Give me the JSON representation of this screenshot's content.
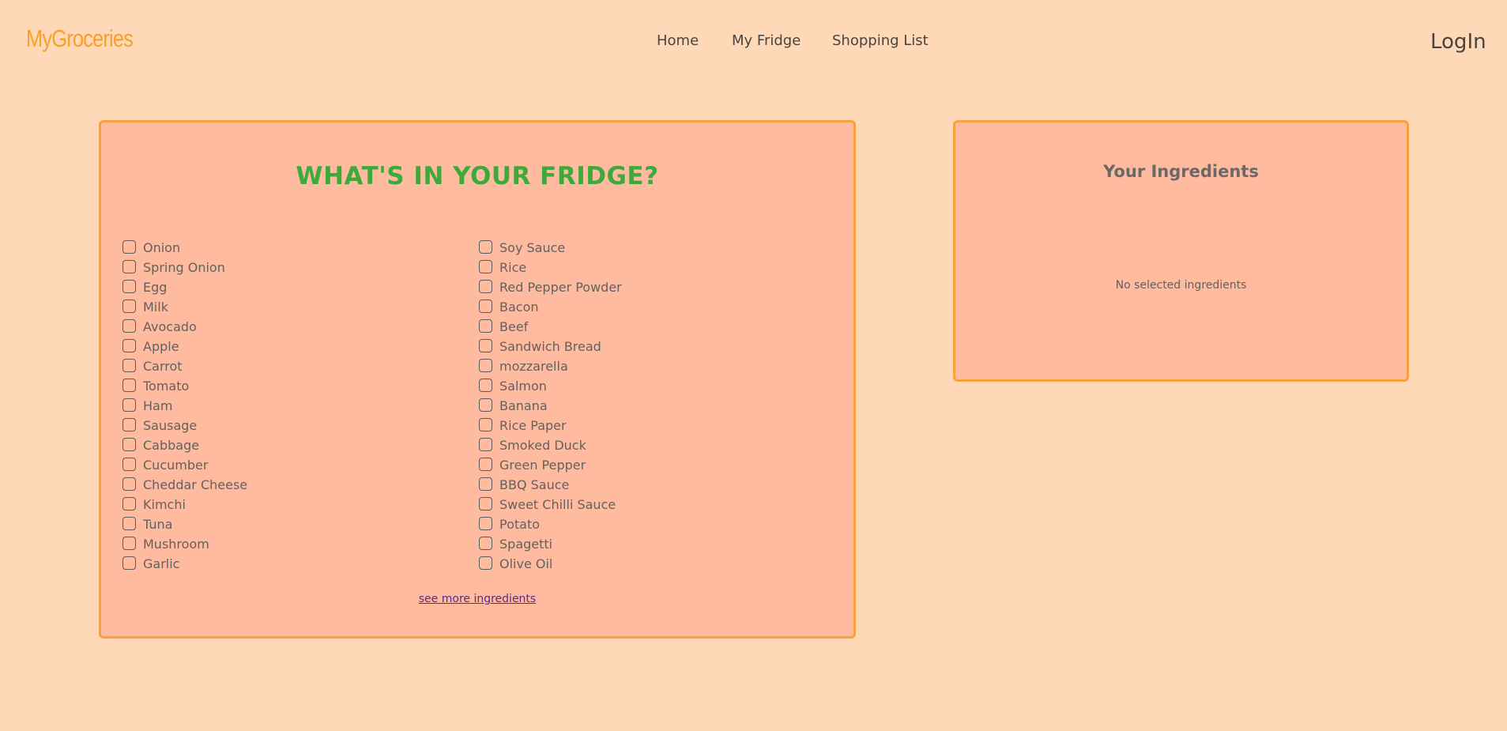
{
  "header": {
    "logo": "MyGroceries",
    "nav": {
      "home": "Home",
      "my_fridge": "My Fridge",
      "shopping_list": "Shopping List"
    },
    "login": "LogIn"
  },
  "fridge": {
    "title": "WHAT'S IN YOUR FRIDGE?",
    "left_column": [
      "Onion",
      "Spring Onion",
      "Egg",
      "Milk",
      "Avocado",
      "Apple",
      "Carrot",
      "Tomato",
      "Ham",
      "Sausage",
      "Cabbage",
      "Cucumber",
      "Cheddar Cheese",
      "Kimchi",
      "Tuna",
      "Mushroom",
      "Garlic"
    ],
    "right_column": [
      "Soy Sauce",
      "Rice",
      "Red Pepper Powder",
      "Bacon",
      "Beef",
      "Sandwich Bread",
      "mozzarella",
      "Salmon",
      "Banana",
      "Rice Paper",
      "Smoked Duck",
      "Green Pepper",
      "BBQ Sauce",
      "Sweet Chilli Sauce",
      "Potato",
      "Spagetti",
      "Olive Oil"
    ],
    "see_more": "see more ingredients"
  },
  "ingredients": {
    "title": "Your Ingredients",
    "empty_text": "No selected ingredients"
  },
  "colors": {
    "background": "#ffd8b8",
    "panel": "#febba0",
    "panel_border": "#f8a23e",
    "logo": "#f7a02a",
    "title_green": "#3eaa3c",
    "link": "#5b2a8a"
  }
}
